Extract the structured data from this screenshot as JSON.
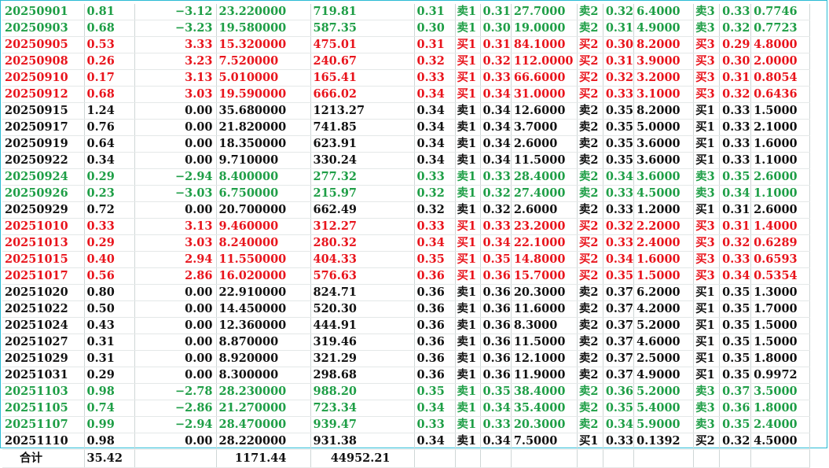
{
  "colors": {
    "up": "#e8141c",
    "down": "#1e9e46",
    "flat": "#111111",
    "frame": "#2bbbd4"
  },
  "rows": [
    {
      "date": "20250901",
      "turnover": "0.81",
      "change": "−3.12",
      "volume": "23.220000",
      "amount": "719.81",
      "price": "0.31",
      "o1": "卖1",
      "p1": "0.31",
      "v1": "27.7000",
      "o2": "卖2",
      "p2": "0.32",
      "v2": "6.4000",
      "o3": "卖3",
      "p3": "0.33",
      "v3": "0.7746",
      "trend": "green"
    },
    {
      "date": "20250903",
      "turnover": "0.68",
      "change": "−3.23",
      "volume": "19.580000",
      "amount": "587.35",
      "price": "0.30",
      "o1": "卖1",
      "p1": "0.30",
      "v1": "19.0000",
      "o2": "卖2",
      "p2": "0.31",
      "v2": "4.9000",
      "o3": "卖3",
      "p3": "0.32",
      "v3": "0.7723",
      "trend": "green"
    },
    {
      "date": "20250905",
      "turnover": "0.53",
      "change": "3.33",
      "volume": "15.320000",
      "amount": "475.01",
      "price": "0.31",
      "o1": "买1",
      "p1": "0.31",
      "v1": "84.1000",
      "o2": "买2",
      "p2": "0.30",
      "v2": "8.2000",
      "o3": "买3",
      "p3": "0.29",
      "v3": "4.8000",
      "trend": "red"
    },
    {
      "date": "20250908",
      "turnover": "0.26",
      "change": "3.23",
      "volume": "7.520000",
      "amount": "240.67",
      "price": "0.32",
      "o1": "买1",
      "p1": "0.32",
      "v1": "112.0000",
      "o2": "买2",
      "p2": "0.31",
      "v2": "3.9000",
      "o3": "买3",
      "p3": "0.30",
      "v3": "2.0000",
      "trend": "red"
    },
    {
      "date": "20250910",
      "turnover": "0.17",
      "change": "3.13",
      "volume": "5.010000",
      "amount": "165.41",
      "price": "0.33",
      "o1": "买1",
      "p1": "0.33",
      "v1": "66.6000",
      "o2": "买2",
      "p2": "0.32",
      "v2": "3.2000",
      "o3": "买3",
      "p3": "0.31",
      "v3": "0.8054",
      "trend": "red"
    },
    {
      "date": "20250912",
      "turnover": "0.68",
      "change": "3.03",
      "volume": "19.590000",
      "amount": "666.02",
      "price": "0.34",
      "o1": "买1",
      "p1": "0.34",
      "v1": "31.0000",
      "o2": "买2",
      "p2": "0.33",
      "v2": "3.1000",
      "o3": "买3",
      "p3": "0.32",
      "v3": "0.6436",
      "trend": "red"
    },
    {
      "date": "20250915",
      "turnover": "1.24",
      "change": "0.00",
      "volume": "35.680000",
      "amount": "1213.27",
      "price": "0.34",
      "o1": "卖1",
      "p1": "0.34",
      "v1": "12.6000",
      "o2": "卖2",
      "p2": "0.35",
      "v2": "8.2000",
      "o3": "买1",
      "p3": "0.33",
      "v3": "1.5000",
      "trend": "black"
    },
    {
      "date": "20250917",
      "turnover": "0.76",
      "change": "0.00",
      "volume": "21.820000",
      "amount": "741.85",
      "price": "0.34",
      "o1": "卖1",
      "p1": "0.34",
      "v1": "3.7000",
      "o2": "卖2",
      "p2": "0.35",
      "v2": "5.0000",
      "o3": "买1",
      "p3": "0.33",
      "v3": "2.1000",
      "trend": "black"
    },
    {
      "date": "20250919",
      "turnover": "0.64",
      "change": "0.00",
      "volume": "18.350000",
      "amount": "623.91",
      "price": "0.34",
      "o1": "卖1",
      "p1": "0.34",
      "v1": "2.6000",
      "o2": "卖2",
      "p2": "0.35",
      "v2": "3.6000",
      "o3": "买1",
      "p3": "0.33",
      "v3": "1.6000",
      "trend": "black"
    },
    {
      "date": "20250922",
      "turnover": "0.34",
      "change": "0.00",
      "volume": "9.710000",
      "amount": "330.24",
      "price": "0.34",
      "o1": "卖1",
      "p1": "0.34",
      "v1": "11.5000",
      "o2": "卖2",
      "p2": "0.35",
      "v2": "3.6000",
      "o3": "买1",
      "p3": "0.33",
      "v3": "1.1000",
      "trend": "black"
    },
    {
      "date": "20250924",
      "turnover": "0.29",
      "change": "−2.94",
      "volume": "8.400000",
      "amount": "277.32",
      "price": "0.33",
      "o1": "卖1",
      "p1": "0.33",
      "v1": "28.4000",
      "o2": "卖2",
      "p2": "0.34",
      "v2": "3.6000",
      "o3": "卖3",
      "p3": "0.35",
      "v3": "2.6000",
      "trend": "green"
    },
    {
      "date": "20250926",
      "turnover": "0.23",
      "change": "−3.03",
      "volume": "6.750000",
      "amount": "215.97",
      "price": "0.32",
      "o1": "卖1",
      "p1": "0.32",
      "v1": "27.4000",
      "o2": "卖2",
      "p2": "0.33",
      "v2": "4.5000",
      "o3": "卖3",
      "p3": "0.34",
      "v3": "1.1000",
      "trend": "green"
    },
    {
      "date": "20250929",
      "turnover": "0.72",
      "change": "0.00",
      "volume": "20.700000",
      "amount": "662.49",
      "price": "0.32",
      "o1": "卖1",
      "p1": "0.32",
      "v1": "2.6000",
      "o2": "卖2",
      "p2": "0.33",
      "v2": "1.2000",
      "o3": "买1",
      "p3": "0.31",
      "v3": "2.6000",
      "trend": "black"
    },
    {
      "date": "20251010",
      "turnover": "0.33",
      "change": "3.13",
      "volume": "9.460000",
      "amount": "312.27",
      "price": "0.33",
      "o1": "买1",
      "p1": "0.33",
      "v1": "23.2000",
      "o2": "买2",
      "p2": "0.32",
      "v2": "2.2000",
      "o3": "买3",
      "p3": "0.31",
      "v3": "1.4000",
      "trend": "red"
    },
    {
      "date": "20251013",
      "turnover": "0.29",
      "change": "3.03",
      "volume": "8.240000",
      "amount": "280.32",
      "price": "0.34",
      "o1": "买1",
      "p1": "0.34",
      "v1": "22.1000",
      "o2": "买2",
      "p2": "0.33",
      "v2": "2.4000",
      "o3": "买3",
      "p3": "0.32",
      "v3": "0.6289",
      "trend": "red"
    },
    {
      "date": "20251015",
      "turnover": "0.40",
      "change": "2.94",
      "volume": "11.550000",
      "amount": "404.33",
      "price": "0.35",
      "o1": "买1",
      "p1": "0.35",
      "v1": "14.8000",
      "o2": "买2",
      "p2": "0.34",
      "v2": "1.6000",
      "o3": "买3",
      "p3": "0.33",
      "v3": "0.6593",
      "trend": "red"
    },
    {
      "date": "20251017",
      "turnover": "0.56",
      "change": "2.86",
      "volume": "16.020000",
      "amount": "576.63",
      "price": "0.36",
      "o1": "买1",
      "p1": "0.36",
      "v1": "15.7000",
      "o2": "买2",
      "p2": "0.35",
      "v2": "1.5000",
      "o3": "买3",
      "p3": "0.34",
      "v3": "0.5354",
      "trend": "red"
    },
    {
      "date": "20251020",
      "turnover": "0.80",
      "change": "0.00",
      "volume": "22.910000",
      "amount": "824.71",
      "price": "0.36",
      "o1": "卖1",
      "p1": "0.36",
      "v1": "20.3000",
      "o2": "卖2",
      "p2": "0.37",
      "v2": "6.2000",
      "o3": "买1",
      "p3": "0.35",
      "v3": "1.3000",
      "trend": "black"
    },
    {
      "date": "20251022",
      "turnover": "0.50",
      "change": "0.00",
      "volume": "14.450000",
      "amount": "520.30",
      "price": "0.36",
      "o1": "卖1",
      "p1": "0.36",
      "v1": "11.6000",
      "o2": "卖2",
      "p2": "0.37",
      "v2": "4.2000",
      "o3": "买1",
      "p3": "0.35",
      "v3": "1.7000",
      "trend": "black"
    },
    {
      "date": "20251024",
      "turnover": "0.43",
      "change": "0.00",
      "volume": "12.360000",
      "amount": "444.91",
      "price": "0.36",
      "o1": "卖1",
      "p1": "0.36",
      "v1": "8.3000",
      "o2": "卖2",
      "p2": "0.37",
      "v2": "5.2000",
      "o3": "买1",
      "p3": "0.35",
      "v3": "1.5000",
      "trend": "black"
    },
    {
      "date": "20251027",
      "turnover": "0.31",
      "change": "0.00",
      "volume": "8.870000",
      "amount": "319.46",
      "price": "0.36",
      "o1": "卖1",
      "p1": "0.36",
      "v1": "11.5000",
      "o2": "卖2",
      "p2": "0.37",
      "v2": "4.6000",
      "o3": "买1",
      "p3": "0.35",
      "v3": "1.5000",
      "trend": "black"
    },
    {
      "date": "20251029",
      "turnover": "0.31",
      "change": "0.00",
      "volume": "8.920000",
      "amount": "321.29",
      "price": "0.36",
      "o1": "卖1",
      "p1": "0.36",
      "v1": "12.1000",
      "o2": "卖2",
      "p2": "0.37",
      "v2": "2.5000",
      "o3": "买1",
      "p3": "0.35",
      "v3": "1.8000",
      "trend": "black"
    },
    {
      "date": "20251031",
      "turnover": "0.29",
      "change": "0.00",
      "volume": "8.300000",
      "amount": "298.68",
      "price": "0.36",
      "o1": "卖1",
      "p1": "0.36",
      "v1": "11.9000",
      "o2": "卖2",
      "p2": "0.37",
      "v2": "4.9000",
      "o3": "买1",
      "p3": "0.35",
      "v3": "0.9972",
      "trend": "black"
    },
    {
      "date": "20251103",
      "turnover": "0.98",
      "change": "−2.78",
      "volume": "28.230000",
      "amount": "988.20",
      "price": "0.35",
      "o1": "卖1",
      "p1": "0.35",
      "v1": "38.4000",
      "o2": "卖2",
      "p2": "0.36",
      "v2": "5.2000",
      "o3": "卖3",
      "p3": "0.37",
      "v3": "3.5000",
      "trend": "green"
    },
    {
      "date": "20251105",
      "turnover": "0.74",
      "change": "−2.86",
      "volume": "21.270000",
      "amount": "723.34",
      "price": "0.34",
      "o1": "卖1",
      "p1": "0.34",
      "v1": "35.4000",
      "o2": "卖2",
      "p2": "0.35",
      "v2": "5.4000",
      "o3": "卖3",
      "p3": "0.36",
      "v3": "1.8000",
      "trend": "green"
    },
    {
      "date": "20251107",
      "turnover": "0.99",
      "change": "−2.94",
      "volume": "28.470000",
      "amount": "939.47",
      "price": "0.33",
      "o1": "卖1",
      "p1": "0.33",
      "v1": "20.3000",
      "o2": "卖2",
      "p2": "0.34",
      "v2": "5.9000",
      "o3": "卖3",
      "p3": "0.35",
      "v3": "2.4000",
      "trend": "green"
    },
    {
      "date": "20251110",
      "turnover": "0.98",
      "change": "0.00",
      "volume": "28.220000",
      "amount": "931.38",
      "price": "0.34",
      "o1": "卖1",
      "p1": "0.34",
      "v1": "7.5000",
      "o2": "买1",
      "p2": "0.33",
      "v2": "0.1392",
      "o3": "买2",
      "p3": "0.32",
      "v3": "4.5000",
      "trend": "black"
    }
  ],
  "totals": {
    "label": "合计",
    "turnover": "35.42",
    "volume": "1171.44",
    "amount": "44952.21"
  }
}
